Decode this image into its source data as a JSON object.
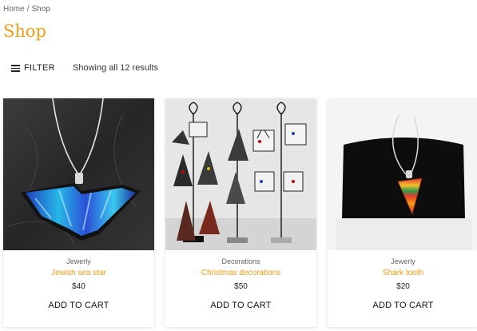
{
  "breadcrumb": {
    "home": "Home",
    "separator": "/",
    "current": "Shop"
  },
  "page": {
    "title": "Shop"
  },
  "toolbar": {
    "filter_label": "FILTER",
    "results_text": "Showing all 12 results"
  },
  "colors": {
    "accent": "#f39c12"
  },
  "products": [
    {
      "category": "Jewerly",
      "name": "Jewish sea star",
      "price": "$40",
      "cart_label": "ADD TO CART"
    },
    {
      "category": "Decorations",
      "name": "Christmas decorations",
      "price": "$50",
      "cart_label": "ADD TO CART"
    },
    {
      "category": "Jewerly",
      "name": "Shark tooth",
      "price": "$20",
      "cart_label": "ADD TO CART"
    }
  ]
}
